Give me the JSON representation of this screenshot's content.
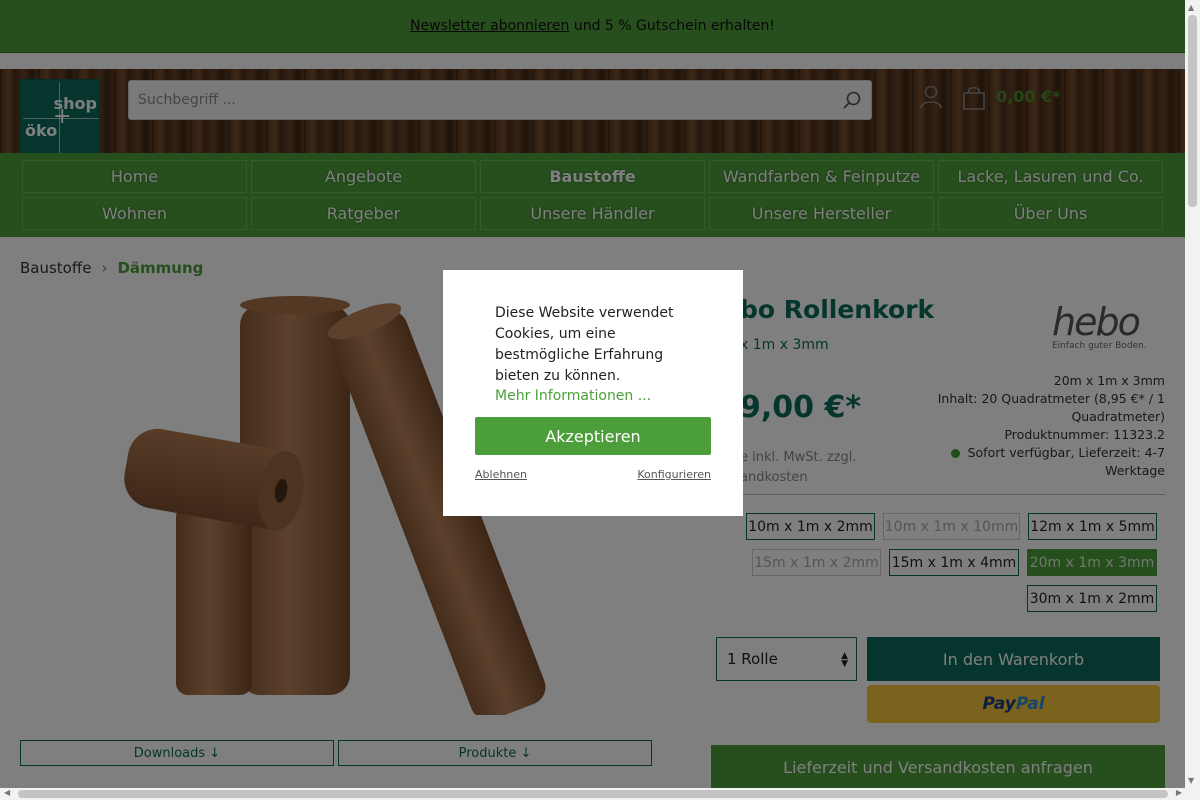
{
  "topbar": {
    "link": "Newsletter abonnieren",
    "text": " und 5 % Gutschein erhalten!"
  },
  "logo": {
    "part1": "shop",
    "part2": "öko",
    "plus": "+"
  },
  "search": {
    "placeholder": "Suchbegriff ..."
  },
  "cart": {
    "total": "0,00 €*"
  },
  "nav": {
    "items": [
      "Home",
      "Angebote",
      "Baustoffe",
      "Wandfarben & Feinputze",
      "Lacke, Lasuren und Co.",
      "Wohnen",
      "Ratgeber",
      "Unsere Händler",
      "Unsere Hersteller",
      "Über Uns"
    ],
    "active": "Baustoffe"
  },
  "breadcrumb": {
    "items": [
      "Baustoffe",
      "Dämmung"
    ],
    "separator": "›"
  },
  "product": {
    "title": "bo Rollenkork",
    "subtitle": "x 1m x 3mm",
    "price": "9,00 €*",
    "tax_line1": "e inkl. MwSt. zzgl.",
    "tax_line2": "andkosten",
    "brand_name": "hebo",
    "brand_slogan": "Einfach guter Boden.",
    "meta": {
      "size": "20m x 1m x 3mm",
      "content": "Inhalt: 20 Quadratmeter (8,95 €* / 1 Quadratmeter)",
      "product_number": "Produktnummer: 11323.2",
      "availability": "Sofort verfügbar, Lieferzeit: 4-7 Werktage"
    },
    "variants": [
      {
        "label": "10m x 1m x 2mm",
        "state": "normal"
      },
      {
        "label": "10m x 1m x 10mm",
        "state": "disabled"
      },
      {
        "label": "12m x 1m x 5mm",
        "state": "normal"
      },
      {
        "label": "15m x 1m x 2mm",
        "state": "disabled"
      },
      {
        "label": "15m x 1m x 4mm",
        "state": "normal"
      },
      {
        "label": "20m x 1m x 3mm",
        "state": "selected"
      },
      {
        "label": "30m x 1m x 2mm",
        "state": "normal"
      }
    ],
    "quantity": "1 Rolle",
    "add_to_cart": "In den Warenkorb",
    "paypal_part1": "Pay",
    "paypal_part2": "Pal",
    "inquiry": "Lieferzeit und Versandkosten anfragen",
    "tabs": [
      "Downloads ↓",
      "Produkte ↓"
    ]
  },
  "cookie": {
    "text": "Diese Website verwendet Cookies, um eine bestmögliche Erfahrung bieten zu können.",
    "more_info": "Mehr Informationen ...",
    "accept": "Akzeptieren",
    "decline": "Ablehnen",
    "configure": "Konfigurieren"
  },
  "colors": {
    "brand_green": "#4c9e3a",
    "dark_teal": "#0b6b5a",
    "paypal_yellow": "#f7c43a"
  },
  "icons": {
    "search": "search-icon",
    "account": "account-icon",
    "cart": "cart-icon",
    "breadcrumb_separator": "chevron-right-icon"
  }
}
